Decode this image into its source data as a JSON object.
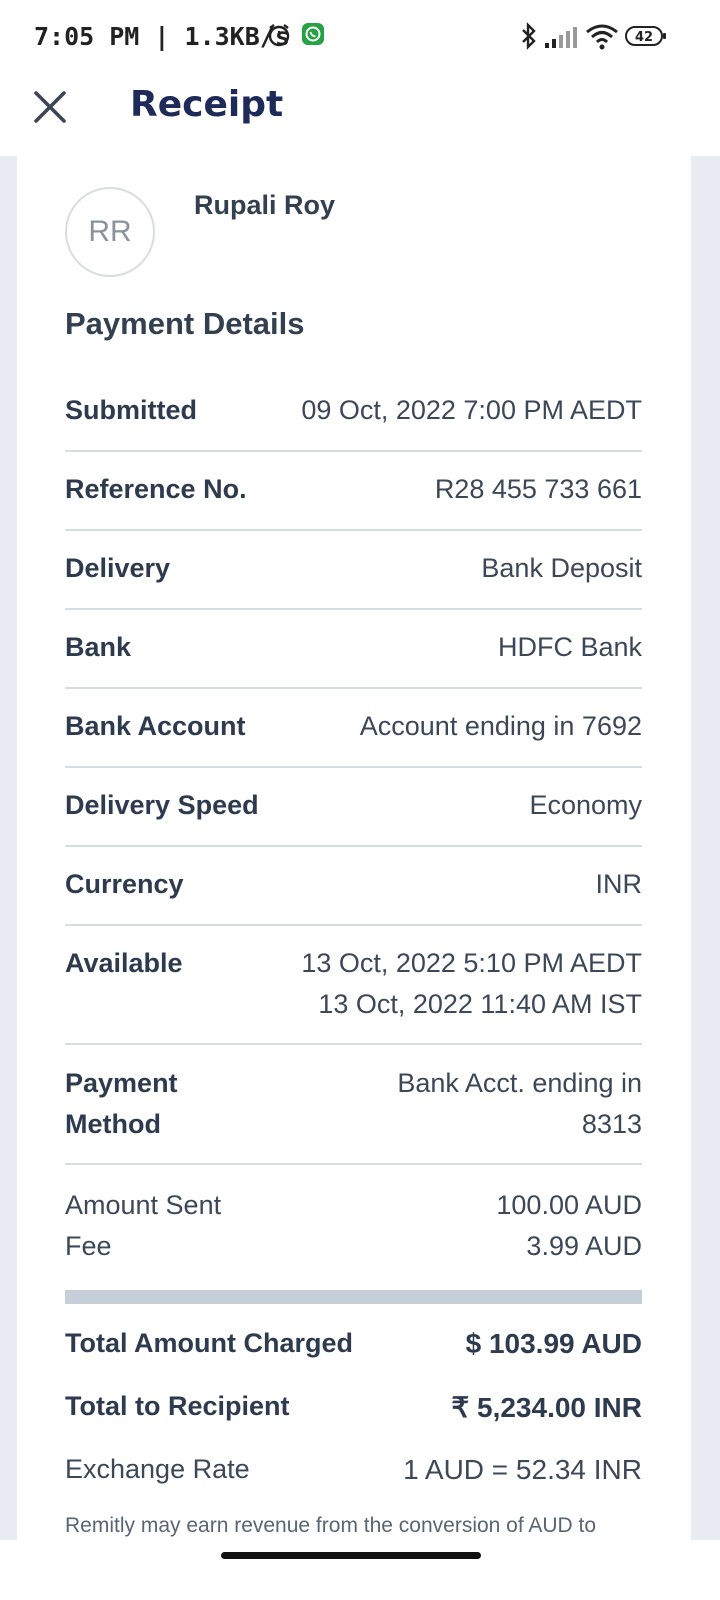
{
  "status_bar": {
    "time": "7:05 PM | 1.3KB/s",
    "battery": "42",
    "icons": [
      "alarm-icon",
      "whatsapp-icon",
      "bluetooth-icon",
      "signal-icon",
      "wifi-icon",
      "battery-icon"
    ]
  },
  "app_bar": {
    "title": "Receipt",
    "close_icon": "close-icon"
  },
  "recipient": {
    "initials": "RR",
    "name": "Rupali Roy"
  },
  "payment_details": {
    "title": "Payment Details",
    "rows": [
      {
        "label": "Submitted",
        "value": "09 Oct, 2022 7:00 PM AEDT"
      },
      {
        "label": "Reference No.",
        "value": "R28 455 733 661"
      },
      {
        "label": "Delivery",
        "value": "Bank Deposit"
      },
      {
        "label": "Bank",
        "value": "HDFC Bank"
      },
      {
        "label": "Bank Account",
        "value": "Account ending in 7692"
      },
      {
        "label": "Delivery Speed",
        "value": "Economy"
      },
      {
        "label": "Currency",
        "value": "INR"
      },
      {
        "label": "Available",
        "value_line1": "13 Oct, 2022 5:10 PM AEDT",
        "value_line2": "13 Oct, 2022 11:40 AM IST"
      },
      {
        "label_line1": "Payment",
        "label_line2": "Method",
        "value_line1": "Bank Acct. ending in",
        "value_line2": "8313"
      }
    ]
  },
  "amounts": {
    "sent_label": "Amount Sent",
    "sent_value": "100.00 AUD",
    "fee_label": "Fee",
    "fee_value": "3.99 AUD"
  },
  "totals": {
    "charged_label": "Total Amount Charged",
    "charged_value": "$ 103.99 AUD",
    "recipient_label": "Total to Recipient",
    "recipient_value": "₹ 5,234.00 INR",
    "rate_label": "Exchange Rate",
    "rate_value": "1 AUD = 52.34 INR"
  },
  "disclaimer": "Remitly may earn revenue from the conversion of AUD to"
}
